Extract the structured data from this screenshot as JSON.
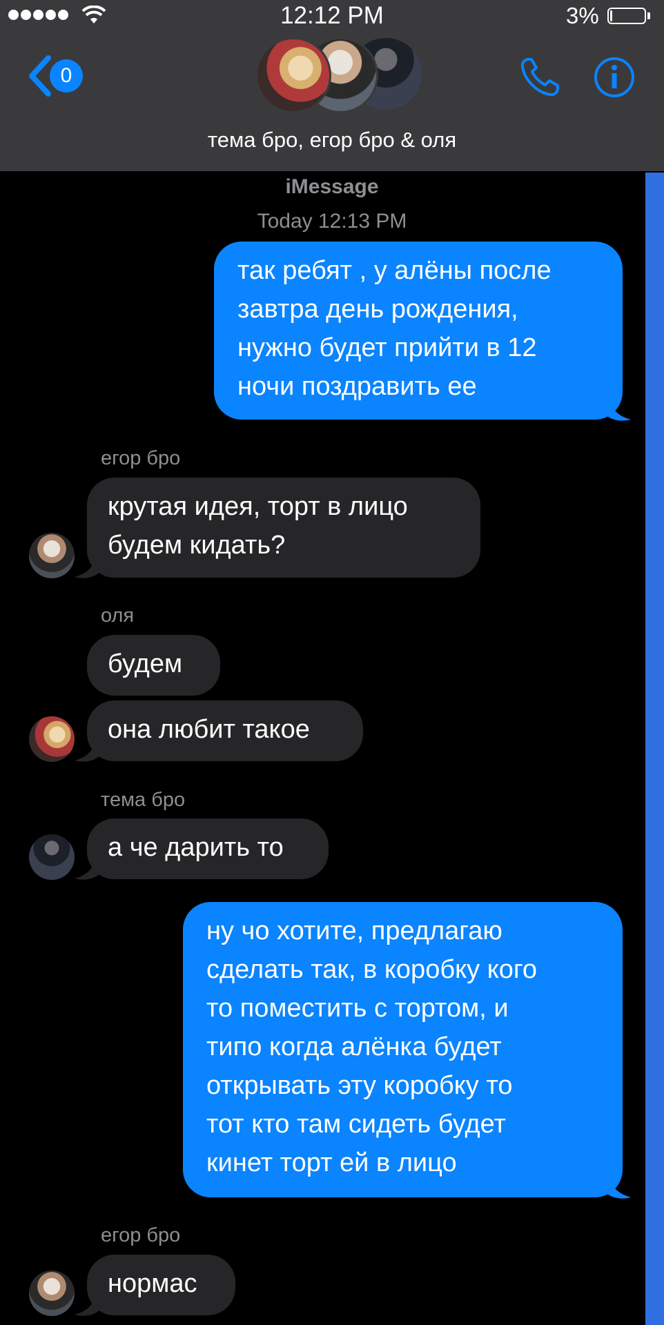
{
  "status_bar": {
    "time": "12:12 PM",
    "battery_percent": "3%",
    "battery_level": 0.03
  },
  "nav": {
    "back_count": "0",
    "group_name": "тема бро, егор бро & оля",
    "back_icon": "chevron-left-icon",
    "phone_icon": "phone-icon",
    "info_icon": "info-icon"
  },
  "thread": {
    "service": "iMessage",
    "timestamp": "Today 12:13 PM"
  },
  "messages": [
    {
      "from": "me",
      "lines": [
        "так ребят , у алёны после",
        "завтра день рождения,",
        "нужно будет прийти в 12",
        "ночи поздравить ее"
      ]
    },
    {
      "from": "егор бро",
      "sender_label": "егор бро",
      "lines": [
        "крутая идея, торт в лицо",
        "будем кидать?"
      ]
    },
    {
      "from": "оля",
      "sender_label": "оля",
      "lines": [
        "будем"
      ]
    },
    {
      "from": "оля",
      "lines": [
        "она любит такое"
      ]
    },
    {
      "from": "тема бро",
      "sender_label": "тема бро",
      "lines": [
        "а че дарить то"
      ]
    },
    {
      "from": "me",
      "lines": [
        "ну чо хотите, предлагаю",
        "сделать так, в коробку кого",
        "то поместить с тортом, и",
        "типо когда алёнка будет",
        "открывать эту коробку то",
        "тот кто там сидеть будет",
        "кинет торт ей в лицо"
      ]
    },
    {
      "from": "егор бро",
      "sender_label": "егор бро",
      "lines": [
        "нормас"
      ]
    }
  ],
  "colors": {
    "outgoing": "#0a84ff",
    "incoming": "#262628",
    "header": "#3a3a3c",
    "scrollbar": "#2f6fe0"
  }
}
